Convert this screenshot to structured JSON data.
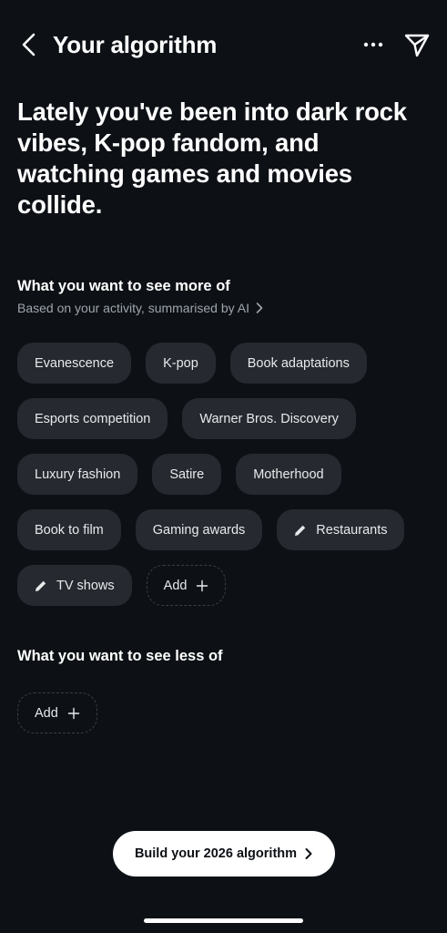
{
  "header": {
    "title": "Your algorithm",
    "back_icon": "chevron-left-icon",
    "more_icon": "more-horizontal-icon",
    "share_icon": "send-icon"
  },
  "headline": "Lately you've been into dark rock vibes, K-pop fandom, and watching games and movies collide.",
  "more_section": {
    "title": "What you want to see more of",
    "subtitle": "Based on your activity, summarised by AI",
    "chips": [
      {
        "label": "Evanescence",
        "icon": null
      },
      {
        "label": "K-pop",
        "icon": null
      },
      {
        "label": "Book adaptations",
        "icon": null
      },
      {
        "label": "Esports competition",
        "icon": null
      },
      {
        "label": "Warner Bros. Discovery",
        "icon": null
      },
      {
        "label": "Luxury fashion",
        "icon": null
      },
      {
        "label": "Satire",
        "icon": null
      },
      {
        "label": "Motherhood",
        "icon": null
      },
      {
        "label": "Book to film",
        "icon": null
      },
      {
        "label": "Gaming awards",
        "icon": null
      },
      {
        "label": "Restaurants",
        "icon": "pencil-icon"
      },
      {
        "label": "TV shows",
        "icon": "pencil-icon"
      }
    ],
    "add_label": "Add"
  },
  "less_section": {
    "title": "What you want to see less of",
    "add_label": "Add"
  },
  "cta": {
    "label": "Build your 2026 algorithm"
  },
  "colors": {
    "background": "#0d1116",
    "chip_background": "#262a30",
    "subtitle_text": "#9ea4ab",
    "cta_background": "#ffffff"
  }
}
